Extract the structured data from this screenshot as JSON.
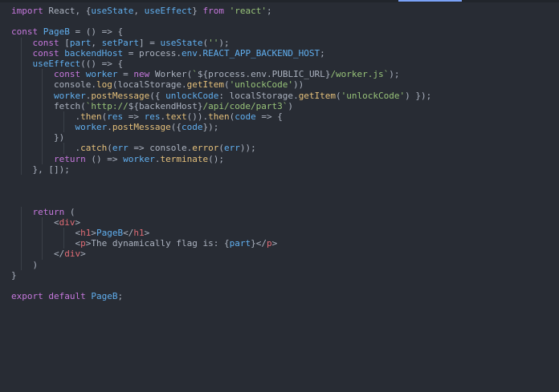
{
  "code_lines": [
    "import React, {useState, useEffect} from 'react';",
    "",
    "const PageB = () => {",
    "    const [part, setPart] = useState('');",
    "    const backendHost = process.env.REACT_APP_BACKEND_HOST;",
    "    useEffect(() => {",
    "        const worker = new Worker(`${process.env.PUBLIC_URL}/worker.js`);",
    "        console.log(localStorage.getItem('unlockCode'))",
    "        worker.postMessage({ unlockCode: localStorage.getItem('unlockCode') });",
    "        fetch(`http://${backendHost}/api/code/part3`)",
    "            .then(res => res.text()).then(code => {",
    "            worker.postMessage({code});",
    "        })",
    "            .catch(err => console.error(err));",
    "        return () => worker.terminate();",
    "    }, []);",
    "",
    "",
    "",
    "    return (",
    "        <div>",
    "            <h1>PageB</h1>",
    "            <p>The dynamically flag is: {part}</p>",
    "        </div>",
    "    )",
    "}",
    "",
    "export default PageB;"
  ],
  "colors": {
    "background": "#282c34",
    "keyword": "#c678dd",
    "identifier": "#61afef",
    "string": "#98c379",
    "function": "#e5c07b",
    "tag": "#e06c75",
    "plain": "#abb2bf"
  }
}
